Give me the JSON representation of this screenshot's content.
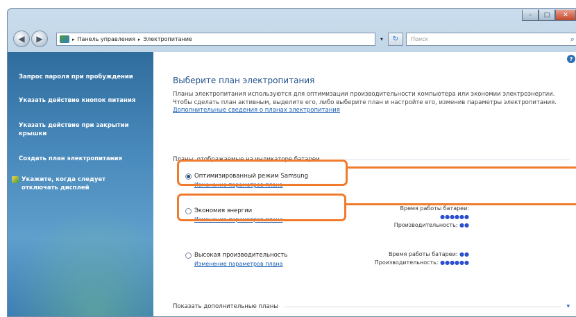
{
  "window": {
    "buttons": {
      "minimize": "–",
      "maximize": "□",
      "close": "✕"
    }
  },
  "navigation": {
    "back_icon": "back-arrow-icon",
    "forward_icon": "forward-arrow-icon",
    "breadcrumb": [
      "Панель управления",
      "Электропитание"
    ],
    "breadcrumb_sep": "▸",
    "search_placeholder": "Поиск"
  },
  "sidebar": {
    "items": [
      {
        "label": "Запрос пароля при пробуждении"
      },
      {
        "label": "Указать действие кнопок питания"
      },
      {
        "label": "Указать действие при закрытии крышки"
      },
      {
        "label": "Создать план электропитания"
      },
      {
        "label": "Укажите, когда следует отключать дисплей"
      }
    ]
  },
  "main": {
    "title": "Выберите план электропитания",
    "intro": "Планы электропитания используются для оптимизации производительности компьютера или экономии электроэнергии. Чтобы сделать план активным, выделите его, либо выберите план и настройте его, изменив параметры электропитания.",
    "intro_link": "Дополнительные сведения о планах электропитания",
    "plans_group": "Планы, отображаемые на индикаторе батареи",
    "change_label": "Изменение параметров плана",
    "battery_life_label": "Время работы батареи:",
    "performance_label": "Производительность:",
    "plans": [
      {
        "name": "Оптимизированный режим Samsung",
        "selected": true
      },
      {
        "name": "Экономия энергии",
        "selected": false,
        "battery_stars": "●●●●●●",
        "perf_stars": "●●"
      },
      {
        "name": "Высокая производительность",
        "selected": false,
        "battery_stars": "●●",
        "perf_stars": "●●●●●●"
      }
    ],
    "more_plans": "Показать дополнительные планы"
  },
  "colors": {
    "callout": "#f07b2c",
    "sidebar": "#3c7db3",
    "link": "#1a5fb4",
    "title": "#1f4f8a"
  }
}
